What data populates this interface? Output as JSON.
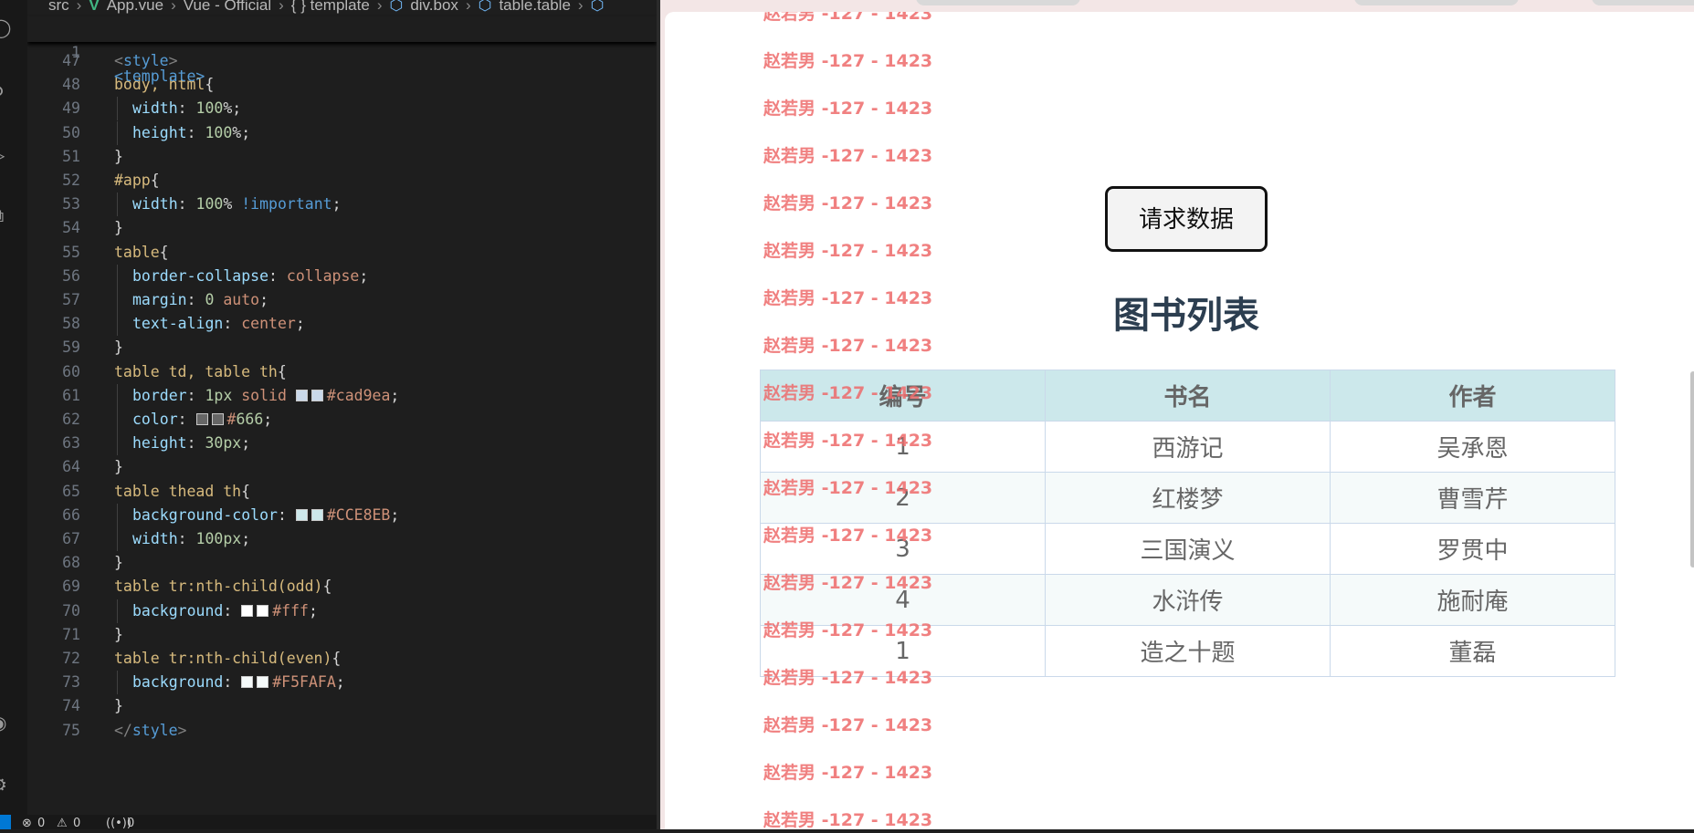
{
  "breadcrumb": {
    "items": [
      "src",
      "App.vue",
      "Vue - Official",
      "{ } template",
      "div.box",
      "table.table"
    ]
  },
  "sticky": {
    "line": "1",
    "code": "<template>"
  },
  "code_lines": [
    {
      "n": "47",
      "text": "<style>"
    },
    {
      "n": "48",
      "text": "body, html{"
    },
    {
      "n": "49",
      "text": "width: 100%;"
    },
    {
      "n": "50",
      "text": "height: 100%;"
    },
    {
      "n": "51",
      "text": "}"
    },
    {
      "n": "52",
      "text": "#app{"
    },
    {
      "n": "53",
      "text": "width: 100% !important;"
    },
    {
      "n": "54",
      "text": "}"
    },
    {
      "n": "55",
      "text": "table{"
    },
    {
      "n": "56",
      "text": "border-collapse: collapse;"
    },
    {
      "n": "57",
      "text": "margin: 0 auto;"
    },
    {
      "n": "58",
      "text": "text-align: center;"
    },
    {
      "n": "59",
      "text": "}"
    },
    {
      "n": "60",
      "text": "table td, table th{"
    },
    {
      "n": "61",
      "text": "border: 1px solid #cad9ea;"
    },
    {
      "n": "62",
      "text": "color: #666;"
    },
    {
      "n": "63",
      "text": "height: 30px;"
    },
    {
      "n": "64",
      "text": "}"
    },
    {
      "n": "65",
      "text": "table thead th{"
    },
    {
      "n": "66",
      "text": "background-color: #CCE8EB;"
    },
    {
      "n": "67",
      "text": "width: 100px;"
    },
    {
      "n": "68",
      "text": "}"
    },
    {
      "n": "69",
      "text": "table tr:nth-child(odd){"
    },
    {
      "n": "70",
      "text": "background: #fff;"
    },
    {
      "n": "71",
      "text": "}"
    },
    {
      "n": "72",
      "text": "table tr:nth-child(even){"
    },
    {
      "n": "73",
      "text": "background: #F5FAFA;"
    },
    {
      "n": "74",
      "text": "}"
    },
    {
      "n": "75",
      "text": "</style>"
    }
  ],
  "status": {
    "errors": "0",
    "warnings": "0",
    "ports": "0"
  },
  "preview": {
    "button_label": "请求数据",
    "title": "图书列表",
    "table": {
      "headers": [
        "编号",
        "书名",
        "作者"
      ],
      "rows": [
        [
          "1",
          "西游记",
          "吴承恩"
        ],
        [
          "2",
          "红楼梦",
          "曹雪芹"
        ],
        [
          "3",
          "三国演义",
          "罗贯中"
        ],
        [
          "4",
          "水浒传",
          "施耐庵"
        ],
        [
          "1",
          "造之十题",
          "董磊"
        ]
      ]
    },
    "watermark": "赵若男 -127 - 1423"
  },
  "colors": {
    "border": "#cad9ea",
    "text": "#666",
    "header_bg": "#CCE8EB",
    "odd_bg": "#fff",
    "even_bg": "#F5FAFA",
    "watermark": "#ee6b6b"
  }
}
